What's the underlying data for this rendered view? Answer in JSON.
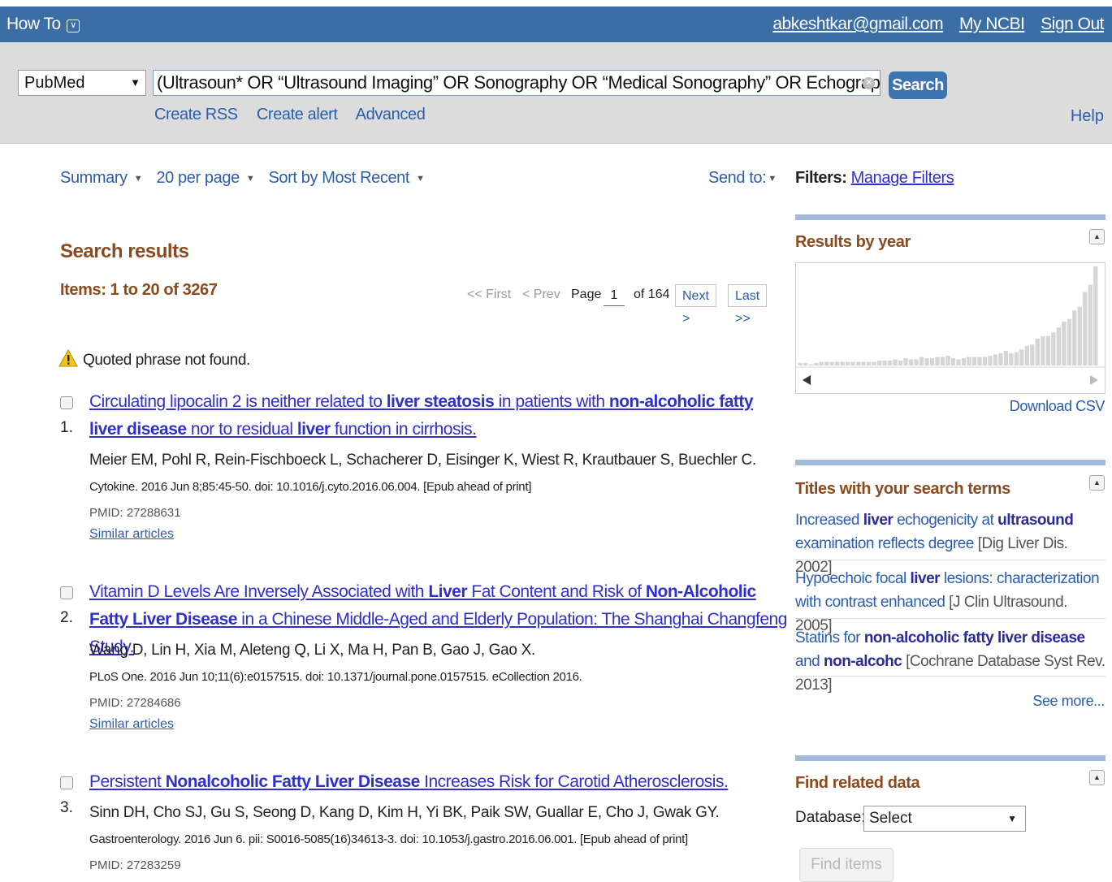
{
  "header": {
    "how_to": "How To",
    "email": "abkeshtkar@gmail.com",
    "my_ncbi": "My NCBI",
    "sign_out": "Sign Out"
  },
  "search": {
    "database": "PubMed",
    "query": "(Ultrasoun* OR “Ultrasound Imaging” OR Sonography OR “Medical Sonography” OR Echography",
    "button": "Search",
    "links": [
      "Create RSS",
      "Create alert",
      "Advanced"
    ],
    "help": "Help"
  },
  "toolbar": {
    "summary": "Summary",
    "per_page": "20 per page",
    "sort": "Sort by Most Recent",
    "send_to": "Send to:"
  },
  "results": {
    "title": "Search results",
    "items": "Items: 1 to 20 of 3267",
    "pager": {
      "first": "<< First",
      "prev": "< Prev",
      "page_label": "Page",
      "page": "1",
      "of": "of 164",
      "next": "Next >",
      "last": "Last >>"
    },
    "warning": "Quoted phrase not found.",
    "list": [
      {
        "num": "1.",
        "title_parts": [
          [
            "Circulating lipocalin 2 is neither related to ",
            false
          ],
          [
            "liver steatosis",
            true
          ],
          [
            " in patients with ",
            false
          ],
          [
            "non-alcoholic fatty liver disease",
            true
          ],
          [
            " nor to residual ",
            false
          ],
          [
            "liver",
            true
          ],
          [
            " function in cirrhosis.",
            false
          ]
        ],
        "authors": "Meier EM, Pohl R, Rein-Fischboeck L, Schacherer D, Eisinger K, Wiest R, Krautbauer S, Buechler C.",
        "journal": "Cytokine. 2016 Jun 8;85:45-50. doi: 10.1016/j.cyto.2016.06.004. [Epub ahead of print]",
        "pmid": "PMID: 27288631",
        "similar": "Similar articles"
      },
      {
        "num": "2.",
        "title_parts": [
          [
            "Vitamin D Levels Are Inversely Associated with ",
            false
          ],
          [
            "Liver",
            true
          ],
          [
            " Fat Content and Risk of ",
            false
          ],
          [
            "Non-Alcoholic Fatty Liver Disease",
            true
          ],
          [
            " in a Chinese Middle-Aged and Elderly Population: The Shanghai Changfeng Study.",
            false
          ]
        ],
        "authors": "Wang D, Lin H, Xia M, Aleteng Q, Li X, Ma H, Pan B, Gao J, Gao X.",
        "journal": "PLoS One. 2016 Jun 10;11(6):e0157515. doi: 10.1371/journal.pone.0157515. eCollection 2016.",
        "pmid": "PMID: 27284686",
        "similar": "Similar articles"
      },
      {
        "num": "3.",
        "title_parts": [
          [
            "Persistent ",
            false
          ],
          [
            "Nonalcoholic Fatty Liver Disease",
            true
          ],
          [
            " Increases Risk for Carotid Atherosclerosis.",
            false
          ]
        ],
        "authors": "Sinn DH, Cho SJ, Gu S, Seong D, Kang D, Kim H, Yi BK, Paik SW, Guallar E, Cho J, Gwak GY.",
        "journal": "Gastroenterology. 2016 Jun 6. pii: S0016-5085(16)34613-3. doi: 10.1053/j.gastro.2016.06.001. [Epub ahead of print]",
        "pmid": "PMID: 27283259",
        "similar": ""
      }
    ]
  },
  "sidebar": {
    "filters_label": "Filters:",
    "manage_filters": "Manage Filters",
    "results_by_year": "Results by year",
    "year_counts_relative": [
      2,
      2,
      1,
      2,
      3,
      3,
      3,
      3,
      3,
      3,
      3,
      3,
      3,
      3,
      3,
      4,
      4,
      4,
      5,
      4,
      6,
      5,
      5,
      7,
      6,
      6,
      7,
      7,
      8,
      6,
      5,
      6,
      7,
      7,
      7,
      7,
      8,
      9,
      10,
      12,
      10,
      11,
      13,
      16,
      17,
      22,
      24,
      24,
      27,
      31,
      36,
      38,
      45,
      48,
      60,
      66,
      81
    ],
    "download_csv": "Download CSV",
    "titles_title": "Titles with your search terms",
    "titles": [
      {
        "parts": [
          [
            "Increased ",
            false
          ],
          [
            "liver",
            true
          ],
          [
            " echogenicity at ",
            false
          ],
          [
            "ultrasound",
            true
          ],
          [
            " examination reflects degree",
            false
          ]
        ],
        "src": "[Dig Liver Dis. 2002]"
      },
      {
        "parts": [
          [
            "Hypoechoic focal ",
            false
          ],
          [
            "liver",
            true
          ],
          [
            " lesions: characterization with contrast enhanced",
            false
          ]
        ],
        "src": "[J Clin Ultrasound. 2005]"
      },
      {
        "parts": [
          [
            "Statins for ",
            false
          ],
          [
            "non-alcoholic fatty liver disease",
            true
          ],
          [
            " and ",
            false
          ],
          [
            "non-alcohc",
            true
          ]
        ],
        "src": "[Cochrane Database Syst Rev. 2013]"
      }
    ],
    "see_more": "See more...",
    "find_related": "Find related data",
    "database_label": "Database:",
    "database_value": "Select",
    "find_items": "Find items"
  }
}
